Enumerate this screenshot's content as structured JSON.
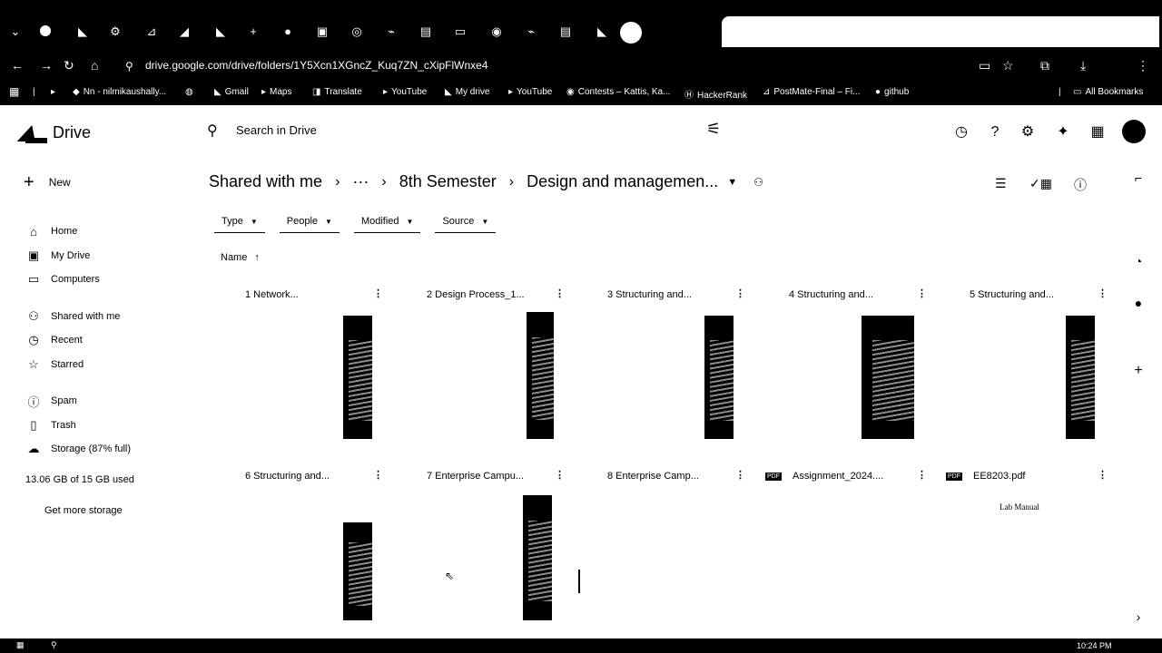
{
  "browser": {
    "url": "drive.google.com/drive/folders/1Y5Xcn1XGncZ_Kuq7ZN_cXipFlWnxe4",
    "bookmarks": [
      {
        "label": "Nn - nilmikaushally...",
        "icon": "bookmark-icon"
      },
      {
        "label": "",
        "icon": "globe-icon"
      },
      {
        "label": "Gmail",
        "icon": "gmail-icon"
      },
      {
        "label": "Maps",
        "icon": "maps-icon"
      },
      {
        "label": "Translate",
        "icon": "translate-icon"
      },
      {
        "label": "YouTube",
        "icon": "youtube-icon"
      },
      {
        "label": "My drive",
        "icon": "drive-icon"
      },
      {
        "label": "YouTube",
        "icon": "youtube-icon"
      },
      {
        "label": "Contests – Kattis, Ka...",
        "icon": "kattis-icon"
      },
      {
        "label": "HackerRank",
        "icon": "hackerrank-icon"
      },
      {
        "label": "PostMate-Final – Fi...",
        "icon": "figma-icon"
      },
      {
        "label": "github",
        "icon": "github-icon"
      }
    ],
    "all_bookmarks": "All Bookmarks"
  },
  "drive": {
    "app_name": "Drive",
    "search_placeholder": "Search in Drive",
    "new_label": "New",
    "sidebar": [
      {
        "label": "Home",
        "icon": "home-icon"
      },
      {
        "label": "My Drive",
        "icon": "my-drive-icon"
      },
      {
        "label": "Computers",
        "icon": "computers-icon"
      },
      {
        "label": "Shared with me",
        "icon": "shared-icon"
      },
      {
        "label": "Recent",
        "icon": "recent-icon"
      },
      {
        "label": "Starred",
        "icon": "star-icon"
      },
      {
        "label": "Spam",
        "icon": "spam-icon"
      },
      {
        "label": "Trash",
        "icon": "trash-icon"
      },
      {
        "label": "Storage (87% full)",
        "icon": "cloud-icon"
      }
    ],
    "storage_used": "13.06 GB of 15 GB used",
    "get_more_storage": "Get more storage",
    "breadcrumb": {
      "root": "Shared with me",
      "ellipsis": "···",
      "middle": "8th Semester",
      "current": "Design and managemen..."
    },
    "filters": [
      "Type",
      "People",
      "Modified",
      "Source"
    ],
    "sort_label": "Name",
    "files": [
      {
        "name": "1 Network...",
        "kind": "image"
      },
      {
        "name": "2 Design Process_1...",
        "kind": "image"
      },
      {
        "name": "3 Structuring and...",
        "kind": "image"
      },
      {
        "name": "4 Structuring and...",
        "kind": "image"
      },
      {
        "name": "5 Structuring and...",
        "kind": "image"
      },
      {
        "name": "6 Structuring and...",
        "kind": "image"
      },
      {
        "name": "7 Enterprise Campu...",
        "kind": "image"
      },
      {
        "name": "8 Enterprise Camp...",
        "kind": "image"
      },
      {
        "name": "Assignment_2024....",
        "kind": "pdf"
      },
      {
        "name": "EE8203.pdf",
        "kind": "pdf",
        "preview_title": "Lab Manual"
      }
    ],
    "pdf_badge": "PDF"
  },
  "taskbar": {
    "clock": "10:24 PM"
  }
}
